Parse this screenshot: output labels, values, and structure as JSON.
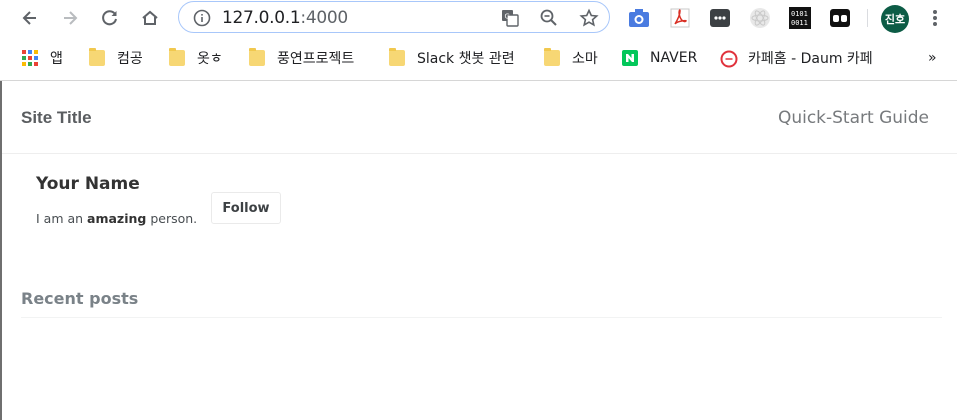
{
  "browser": {
    "url_host": "127.0.0.1",
    "url_port": ":4000",
    "profile_initials": "진호",
    "more_bookmarks": "»"
  },
  "bookmarks": [
    {
      "label": "앱",
      "icon": "apps-grid-icon"
    },
    {
      "label": "컴공",
      "icon": "folder-icon"
    },
    {
      "label": "옷ㅎ",
      "icon": "folder-icon"
    },
    {
      "label": "풍연프로젝트",
      "icon": "folder-icon"
    },
    {
      "label": "Slack 챗봇 관련",
      "icon": "folder-icon"
    },
    {
      "label": "소마",
      "icon": "folder-icon"
    },
    {
      "label": "NAVER",
      "icon": "naver-icon"
    },
    {
      "label": "카페홈 - Daum 카페",
      "icon": "daum-cafe-icon"
    }
  ],
  "site": {
    "title": "Site Title",
    "nav_link": "Quick-Start Guide"
  },
  "author": {
    "name": "Your Name",
    "bio_prefix": "I am an ",
    "bio_bold": "amazing",
    "bio_suffix": " person.",
    "follow_label": "Follow"
  },
  "section": {
    "recent_posts": "Recent posts"
  }
}
